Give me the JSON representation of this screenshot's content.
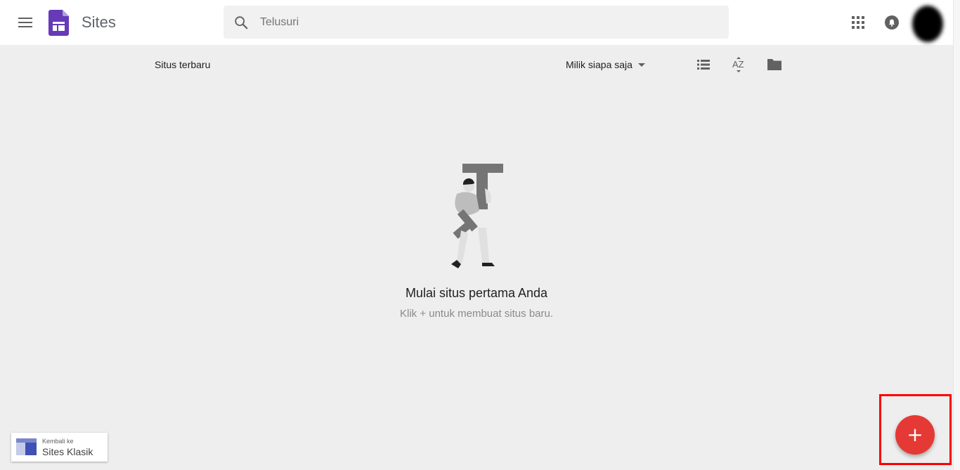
{
  "header": {
    "app_title": "Sites",
    "search": {
      "placeholder": "Telusuri",
      "value": ""
    },
    "icons": [
      "menu-icon",
      "sites-logo-icon",
      "search-icon",
      "apps-grid-icon",
      "notifications-icon",
      "account-avatar"
    ]
  },
  "toolbar": {
    "section_title": "Situs terbaru",
    "owner_filter": "Milik siapa saja",
    "sort_label": "AZ"
  },
  "empty_state": {
    "title": "Mulai situs pertama Anda",
    "subtitle": "Klik + untuk membuat situs baru."
  },
  "classic_link": {
    "small": "Kembali ke",
    "label": "Sites Klasik"
  },
  "fab": {
    "label": "+"
  },
  "colors": {
    "accent": "#e53935",
    "logo": "#673ab7",
    "highlight": "#ff0000"
  }
}
